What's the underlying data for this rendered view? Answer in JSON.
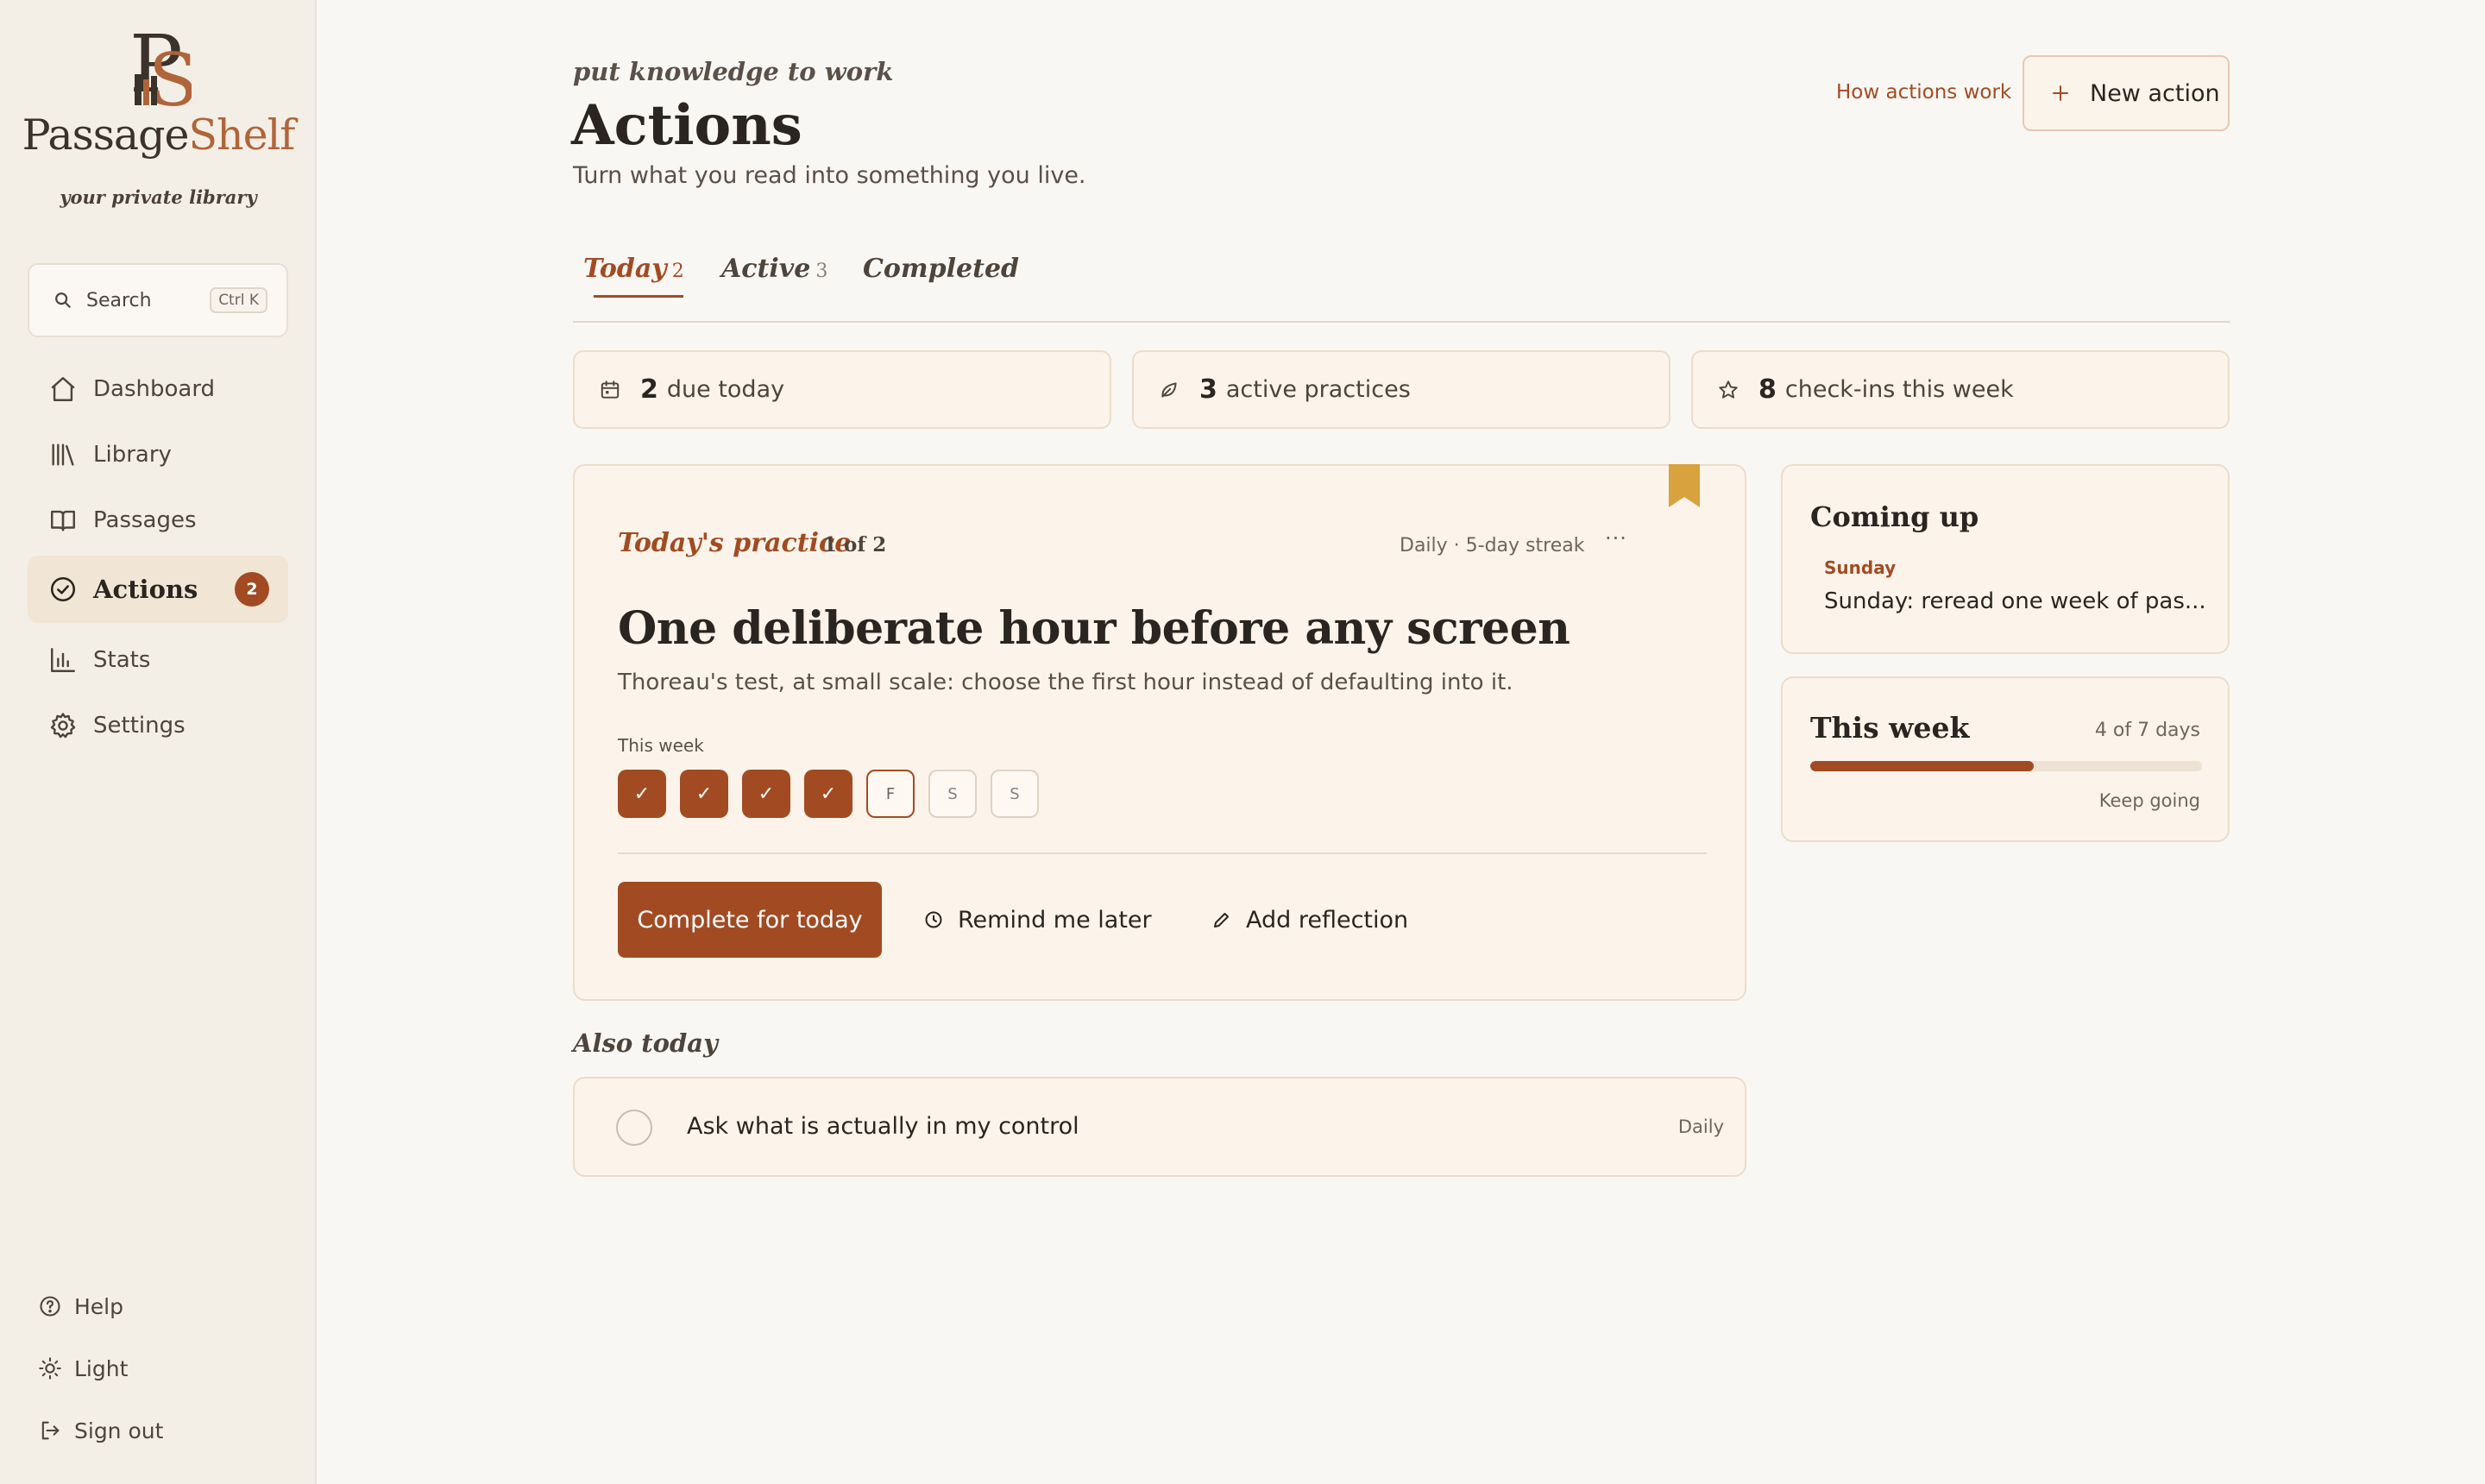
{
  "brand": {
    "name_a": "Passage",
    "name_b": "Shelf",
    "tagline": "your private library",
    "accent": "#a24b22"
  },
  "search": {
    "label": "Search",
    "shortcut": "Ctrl K"
  },
  "nav": {
    "items": [
      {
        "label": "Dashboard",
        "icon": "home-icon"
      },
      {
        "label": "Library",
        "icon": "library-icon"
      },
      {
        "label": "Passages",
        "icon": "book-open-icon"
      },
      {
        "label": "Actions",
        "icon": "check-circle-icon",
        "badge": "2",
        "active": true
      },
      {
        "label": "Stats",
        "icon": "bar-chart-icon"
      },
      {
        "label": "Settings",
        "icon": "gear-icon"
      }
    ],
    "bottom": [
      {
        "label": "Help",
        "icon": "help-icon"
      },
      {
        "label": "Light",
        "icon": "sun-icon"
      },
      {
        "label": "Sign out",
        "icon": "sign-out-icon"
      }
    ]
  },
  "header": {
    "eyebrow": "put knowledge to work",
    "title": "Actions",
    "subtitle": "Turn what you read into something you live.",
    "how_link": "How actions work",
    "new_button": "New action"
  },
  "tabs": [
    {
      "label": "Today",
      "count": "2",
      "active": true
    },
    {
      "label": "Active",
      "count": "3"
    },
    {
      "label": "Completed",
      "count": ""
    }
  ],
  "stats": [
    {
      "value": "2",
      "label": "due today",
      "icon": "calendar-icon"
    },
    {
      "value": "3",
      "label": "active practices",
      "icon": "leaf-icon"
    },
    {
      "value": "8",
      "label": "check-ins this week",
      "icon": "star-icon"
    }
  ],
  "practice": {
    "label": "Today's practice",
    "position": "1 of 2",
    "meta": "Daily · 5-day streak",
    "more": "···",
    "title": "One deliberate hour before any screen",
    "description": "Thoreau's test, at small scale: choose the first hour instead of defaulting into it.",
    "week_label": "This week",
    "days": [
      {
        "text": "✓",
        "state": "done"
      },
      {
        "text": "✓",
        "state": "done"
      },
      {
        "text": "✓",
        "state": "done"
      },
      {
        "text": "✓",
        "state": "done"
      },
      {
        "text": "F",
        "state": "today"
      },
      {
        "text": "S",
        "state": "future"
      },
      {
        "text": "S",
        "state": "future"
      }
    ],
    "complete_button": "Complete for today",
    "remind_button": "Remind me later",
    "reflect_button": "Add reflection"
  },
  "also_today": {
    "title": "Also today",
    "items": [
      {
        "text": "Ask what is actually in my control",
        "frequency": "Daily"
      }
    ]
  },
  "coming_up": {
    "title": "Coming up",
    "day": "Sunday",
    "text": "Sunday: reread one week of pas..."
  },
  "this_week": {
    "title": "This week",
    "count": "4 of 7 days",
    "progress": 0.57,
    "note": "Keep going"
  }
}
